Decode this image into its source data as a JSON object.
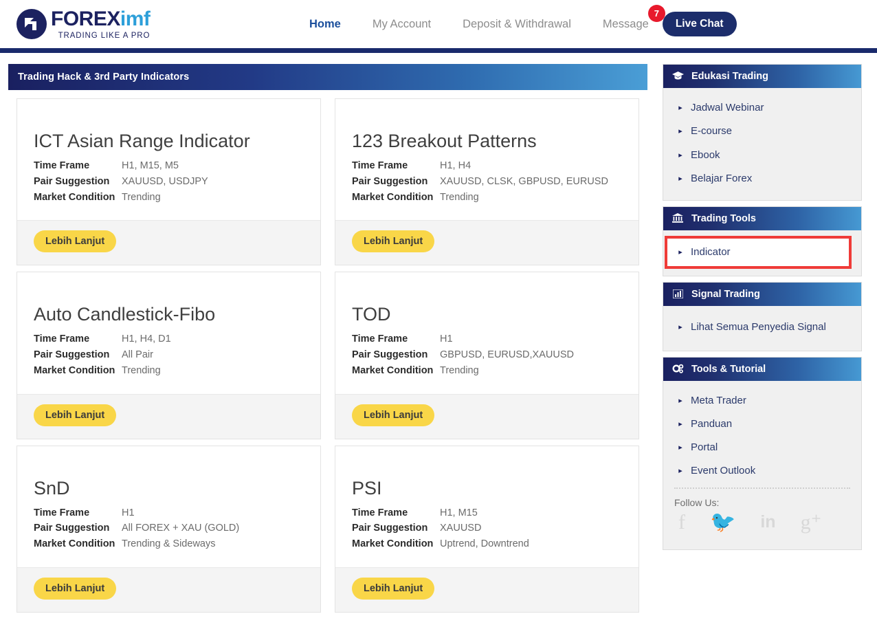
{
  "header": {
    "logo": {
      "name_bold": "FOREX",
      "name_light": "imf",
      "tagline": "TRADING LIKE A PRO"
    },
    "nav": [
      {
        "label": "Home",
        "active": true
      },
      {
        "label": "My Account",
        "active": false
      },
      {
        "label": "Deposit & Withdrawal",
        "active": false
      },
      {
        "label": "Message",
        "active": false,
        "badge": "7"
      }
    ],
    "live_chat_label": "Live Chat"
  },
  "main": {
    "panel_title": "Trading Hack & 3rd Party Indicators",
    "spec_labels": {
      "time_frame": "Time Frame",
      "pair_suggestion": "Pair Suggestion",
      "market_condition": "Market Condition"
    },
    "cta_label": "Lebih Lanjut",
    "cards": [
      {
        "title": "ICT Asian Range Indicator",
        "time_frame": "H1, M15, M5",
        "pair_suggestion": "XAUUSD, USDJPY",
        "market_condition": "Trending"
      },
      {
        "title": "123 Breakout Patterns",
        "time_frame": "H1, H4",
        "pair_suggestion": "XAUUSD, CLSK, GBPUSD, EURUSD",
        "market_condition": "Trending"
      },
      {
        "title": "Auto Candlestick-Fibo",
        "time_frame": "H1, H4, D1",
        "pair_suggestion": "All Pair",
        "market_condition": "Trending"
      },
      {
        "title": "TOD",
        "time_frame": "H1",
        "pair_suggestion": "GBPUSD, EURUSD,XAUUSD",
        "market_condition": "Trending"
      },
      {
        "title": "SnD",
        "time_frame": "H1",
        "pair_suggestion": "All FOREX + XAU (GOLD)",
        "market_condition": "Trending & Sideways"
      },
      {
        "title": "PSI",
        "time_frame": "H1, M15",
        "pair_suggestion": "XAUUSD",
        "market_condition": "Uptrend, Downtrend"
      }
    ]
  },
  "sidebar": {
    "boxes": [
      {
        "title": "Edukasi Trading",
        "icon": "graduation-cap-icon",
        "icon_glyph": "🎓",
        "items": [
          {
            "label": "Jadwal Webinar"
          },
          {
            "label": "E-course"
          },
          {
            "label": "Ebook"
          },
          {
            "label": "Belajar Forex"
          }
        ]
      },
      {
        "title": "Trading Tools",
        "icon": "bank-icon",
        "icon_glyph": "🏛",
        "items": [
          {
            "label": "Indicator",
            "highlighted": true
          }
        ]
      },
      {
        "title": "Signal Trading",
        "icon": "bar-chart-icon",
        "icon_glyph": "📊",
        "items": [
          {
            "label": "Lihat Semua Penyedia Signal"
          }
        ]
      },
      {
        "title": "Tools & Tutorial",
        "icon": "gears-icon",
        "icon_glyph": "⚙",
        "items": [
          {
            "label": "Meta Trader"
          },
          {
            "label": "Panduan"
          },
          {
            "label": "Portal"
          },
          {
            "label": "Event Outlook"
          }
        ]
      }
    ],
    "follow_us_label": "Follow Us:",
    "social": [
      {
        "name": "facebook-icon",
        "glyph": "f"
      },
      {
        "name": "twitter-icon",
        "glyph": "🐦"
      },
      {
        "name": "linkedin-icon",
        "glyph": "in"
      },
      {
        "name": "google-plus-icon",
        "glyph": "g⁺"
      }
    ]
  },
  "colors": {
    "navy": "#1a2a6c",
    "accent_blue": "#4699d3",
    "yellow": "#f9d648",
    "badge_red": "#e8192c",
    "highlight_red": "#ef3b38"
  }
}
